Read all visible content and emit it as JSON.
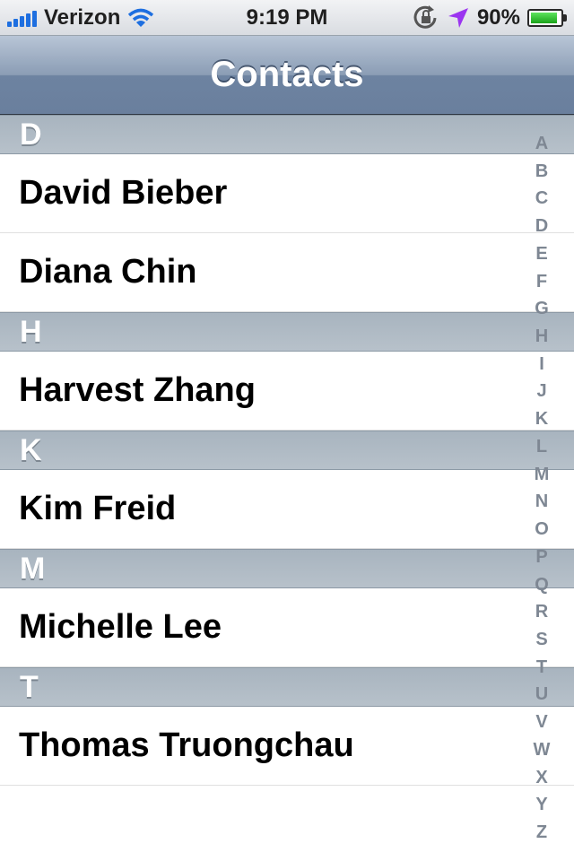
{
  "status_bar": {
    "carrier": "Verizon",
    "time": "9:19 PM",
    "battery_percent": "90%",
    "battery_level": 0.9,
    "signal_bars": 5,
    "icons": [
      "signal-icon",
      "wifi-icon",
      "rotation-lock-icon",
      "location-icon",
      "battery-icon"
    ]
  },
  "nav": {
    "title": "Contacts"
  },
  "sections": [
    {
      "letter": "D",
      "contacts": [
        "David Bieber",
        "Diana Chin"
      ]
    },
    {
      "letter": "H",
      "contacts": [
        "Harvest Zhang"
      ]
    },
    {
      "letter": "K",
      "contacts": [
        "Kim Freid"
      ]
    },
    {
      "letter": "M",
      "contacts": [
        "Michelle Lee"
      ]
    },
    {
      "letter": "T",
      "contacts": [
        "Thomas Truongchau"
      ]
    }
  ],
  "index": [
    "A",
    "B",
    "C",
    "D",
    "E",
    "F",
    "G",
    "H",
    "I",
    "J",
    "K",
    "L",
    "M",
    "N",
    "O",
    "P",
    "Q",
    "R",
    "S",
    "T",
    "U",
    "V",
    "W",
    "X",
    "Y",
    "Z"
  ],
  "colors": {
    "accent_location": "#9b35f0",
    "battery_green": "#1aa31a",
    "signal_blue": "#1e6fe0"
  }
}
